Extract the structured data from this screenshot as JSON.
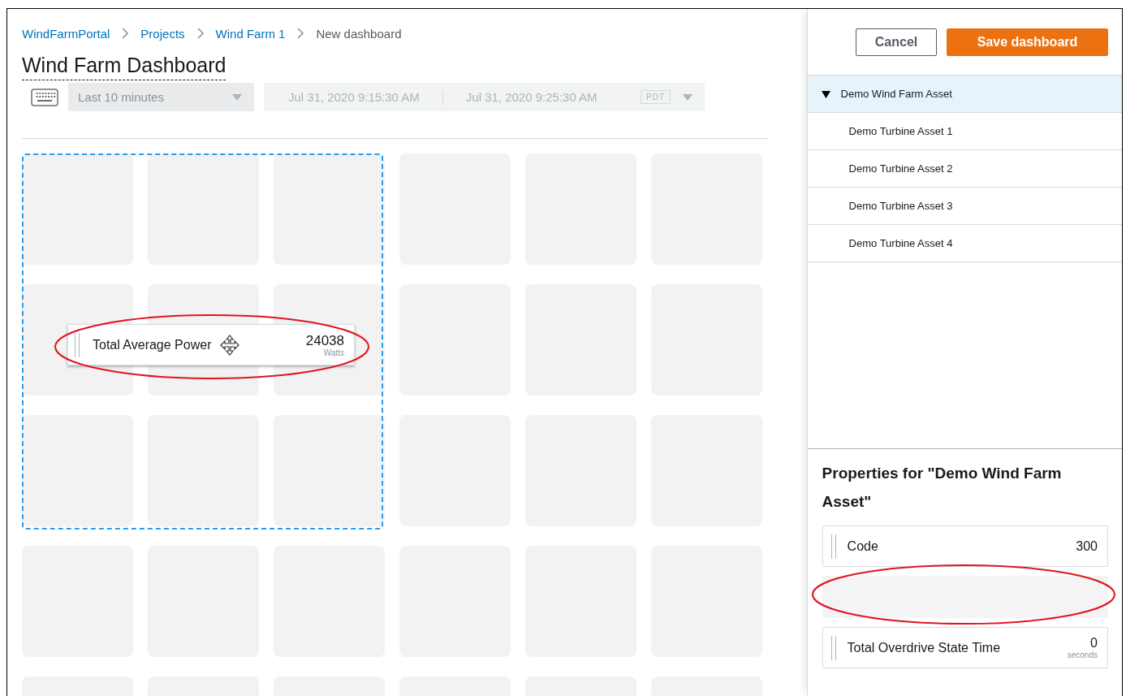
{
  "breadcrumbs": [
    {
      "label": "WindFarmPortal",
      "kind": "link"
    },
    {
      "label": "Projects",
      "kind": "link"
    },
    {
      "label": "Wind Farm 1",
      "kind": "link"
    },
    {
      "label": "New dashboard",
      "kind": "current"
    }
  ],
  "title": "Wind Farm Dashboard",
  "time_range": {
    "preset": "Last 10 minutes",
    "start": "Jul 31, 2020 9:15:30 AM",
    "end": "Jul 31, 2020 9:25:30 AM",
    "timezone": "PDT",
    "disabled": true
  },
  "dragged_widget": {
    "label": "Total Average Power",
    "value": "24038",
    "unit": "Watts"
  },
  "actions": [
    {
      "label": "Cancel",
      "kind": "secondary"
    },
    {
      "label": "Save dashboard",
      "kind": "primary"
    }
  ],
  "asset_tree": [
    {
      "label": "Demo Wind Farm Asset",
      "selected": true,
      "expanded": true,
      "children": [
        {
          "label": "Demo Turbine Asset 1",
          "selected": false
        },
        {
          "label": "Demo Turbine Asset 2",
          "selected": false
        },
        {
          "label": "Demo Turbine Asset 3",
          "selected": false
        },
        {
          "label": "Demo Turbine Asset 4",
          "selected": false
        }
      ]
    }
  ],
  "properties": {
    "title": "Properties for \"Demo Wind Farm Asset\"",
    "items": [
      {
        "kind": "property",
        "label": "Code",
        "value": "300"
      },
      {
        "kind": "placeholder"
      },
      {
        "kind": "property",
        "label": "Total Overdrive State Time",
        "value": "0",
        "unit": "seconds"
      }
    ]
  }
}
